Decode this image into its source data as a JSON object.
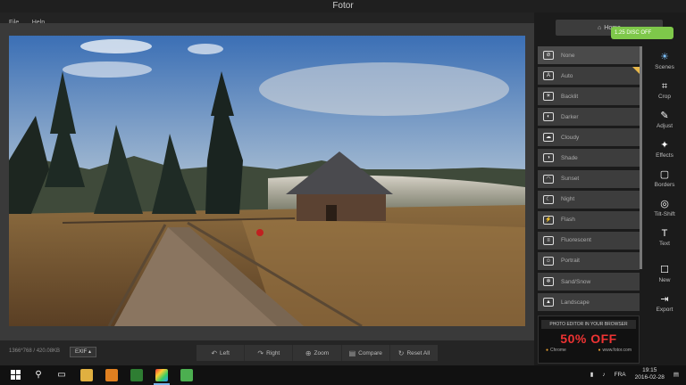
{
  "app": {
    "title": "Fotor",
    "menu": [
      "File",
      "Help"
    ]
  },
  "canvas": {
    "image_info": "1366*768 / 420.08KB",
    "exif_label": "EXIF ▴",
    "tools": [
      {
        "icon": "rotate-left-icon",
        "glyph": "↶",
        "label": "Left"
      },
      {
        "icon": "rotate-right-icon",
        "glyph": "↷",
        "label": "Right"
      },
      {
        "icon": "zoom-icon",
        "glyph": "⊕",
        "label": "Zoom"
      },
      {
        "icon": "compare-icon",
        "glyph": "▤",
        "label": "Compare"
      },
      {
        "icon": "reset-icon",
        "glyph": "↻",
        "label": "Reset All"
      }
    ]
  },
  "sidepanel": {
    "home_label": "Home",
    "promo_text": "1.25 DISC OFF",
    "scenes": [
      {
        "label": "None",
        "icon": "none-icon",
        "glyph": "⊘",
        "active": true
      },
      {
        "label": "Auto",
        "icon": "auto-icon",
        "glyph": "A"
      },
      {
        "label": "Backlit",
        "icon": "backlit-icon",
        "glyph": "☀"
      },
      {
        "label": "Darker",
        "icon": "darker-icon",
        "glyph": "◐"
      },
      {
        "label": "Cloudy",
        "icon": "cloudy-icon",
        "glyph": "☁"
      },
      {
        "label": "Shade",
        "icon": "shade-icon",
        "glyph": "◑"
      },
      {
        "label": "Sunset",
        "icon": "sunset-icon",
        "glyph": "◠"
      },
      {
        "label": "Night",
        "icon": "night-icon",
        "glyph": "☾"
      },
      {
        "label": "Flash",
        "icon": "flash-icon",
        "glyph": "⚡"
      },
      {
        "label": "Fluorescent",
        "icon": "fluorescent-icon",
        "glyph": "≡"
      },
      {
        "label": "Portrait",
        "icon": "portrait-icon",
        "glyph": "☺"
      },
      {
        "label": "Sand/Snow",
        "icon": "sand-snow-icon",
        "glyph": "❄"
      },
      {
        "label": "Landscape",
        "icon": "landscape-icon",
        "glyph": "▲"
      }
    ],
    "rail": [
      {
        "label": "Scenes",
        "icon": "scenes-icon",
        "glyph": "☀",
        "active": true
      },
      {
        "label": "Crop",
        "icon": "crop-icon",
        "glyph": "⌗"
      },
      {
        "label": "Adjust",
        "icon": "adjust-icon",
        "glyph": "✎"
      },
      {
        "label": "Effects",
        "icon": "effects-icon",
        "glyph": "✦"
      },
      {
        "label": "Borders",
        "icon": "borders-icon",
        "glyph": "▢"
      },
      {
        "label": "Tilt-Shift",
        "icon": "tilt-shift-icon",
        "glyph": "◎"
      },
      {
        "label": "Text",
        "icon": "text-icon",
        "glyph": "T"
      }
    ],
    "rail_bottom": [
      {
        "label": "New",
        "icon": "new-icon",
        "glyph": "☐"
      },
      {
        "label": "Export",
        "icon": "export-icon",
        "glyph": "⇥"
      }
    ],
    "ad": {
      "headline": "PHOTO EDITOR IN YOUR BROWSER",
      "offer": "50% OFF",
      "left": "Chrome",
      "right": "www.fotor.com"
    }
  },
  "taskbar": {
    "lang": "FRA",
    "time": "19:15",
    "date": "2016-02-28"
  },
  "colors": {
    "accent": "#7ec3ff",
    "promo_green": "#7ec84a",
    "offer_red": "#e33333"
  }
}
